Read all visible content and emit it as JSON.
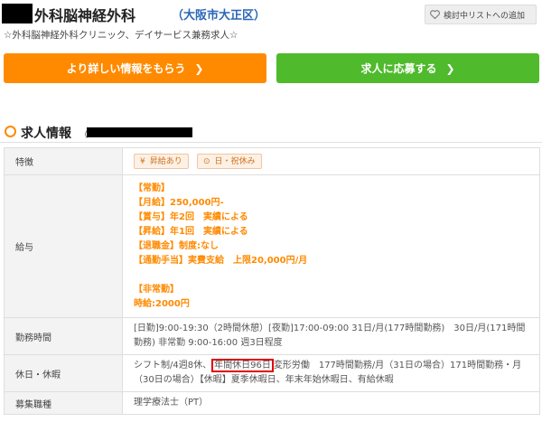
{
  "header": {
    "title": "外科脳神経外科",
    "location": "（大阪市大正区）",
    "watch_label": "検討中リストへの追加"
  },
  "subtitle": "☆外科脳神経外科クリニック、デイサービス兼務求人☆",
  "buttons": {
    "info_label": "より詳しい情報をもらう",
    "apply_label": "求人に応募する"
  },
  "section": {
    "title": "求人情報",
    "subtitle_prefix": "（"
  },
  "table": {
    "rows": {
      "features": {
        "label": "特徴",
        "tags": [
          {
            "icon": "¥",
            "label": "昇給あり"
          },
          {
            "icon": "⊙",
            "label": "日・祝休み"
          }
        ]
      },
      "salary": {
        "label": "給与",
        "lines": [
          "【常勤】",
          "【月給】250,000円-",
          "【賞与】年2回　実績による",
          "【昇給】年1回　実績による",
          "【退職金】制度:なし",
          "【通勤手当】実費支給　上限20,000円/月",
          "",
          "【非常勤】",
          "時給:2000円"
        ]
      },
      "hours": {
        "label": "勤務時間",
        "text": "[日勤]9:00-19:30（2時間休憩）[夜勤]17:00-09:00 31日/月(177時間勤務)　30日/月(171時間勤務) 非常勤 9:00-16:00 週3日程度"
      },
      "holidays": {
        "label": "休日・休暇",
        "before": "シフト制/4週8休、",
        "highlight": "年間休日96日",
        "after": "変形労働　177時間勤務/月（31日の場合）171時間勤務・月（30日の場合）【休暇】夏季休暇日、年末年始休暇日、有給休暇"
      },
      "position": {
        "label": "募集職種",
        "text": "理学療法士（PT）"
      }
    }
  },
  "colors": {
    "orange": "#ff8a00",
    "green": "#4fba2c",
    "link_blue": "#2a66b8",
    "highlight_red": "#e00000"
  }
}
